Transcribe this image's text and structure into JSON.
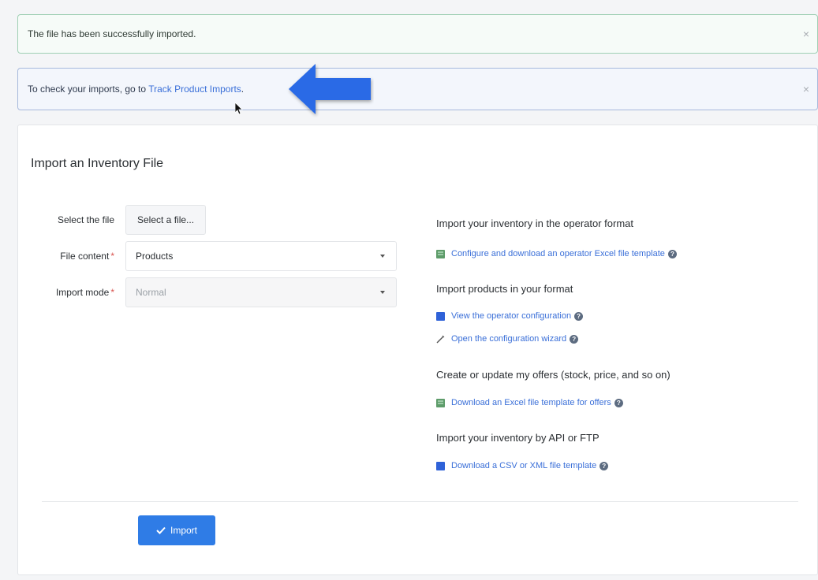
{
  "alerts": {
    "success": {
      "text": "The file has been successfully imported.",
      "close": "×"
    },
    "info": {
      "prefix": "To check your imports, go to ",
      "link": "Track Product Imports",
      "suffix": ".",
      "close": "×"
    }
  },
  "panel": {
    "title": "Import an Inventory File",
    "form": {
      "file_label": "Select the file",
      "file_button": "Select a file...",
      "content_label": "File content",
      "content_value": "Products",
      "mode_label": "Import mode",
      "mode_value": "Normal",
      "required_mark": "*"
    },
    "sections": [
      {
        "heading": "Import your inventory in the operator format",
        "links": [
          {
            "text": "Configure and download an operator Excel file template",
            "icon": "excel-icon"
          }
        ]
      },
      {
        "heading": "Import products in your format",
        "links": [
          {
            "text": "View the operator configuration",
            "icon": "book-icon"
          },
          {
            "text": "Open the configuration wizard",
            "icon": "magic-wand-icon"
          }
        ]
      },
      {
        "heading": "Create or update my offers (stock, price, and so on)",
        "links": [
          {
            "text": "Download an Excel file template for offers",
            "icon": "excel-icon"
          }
        ]
      },
      {
        "heading": "Import your inventory by API or FTP",
        "links": [
          {
            "text": "Download a CSV or XML file template",
            "icon": "book-icon"
          }
        ]
      }
    ],
    "help_glyph": "?",
    "import_button": "Import"
  },
  "colors": {
    "primary": "#2f7ce6",
    "link": "#3a6fd8",
    "success_border": "#9fcfb4",
    "info_border": "#a7b9dc",
    "required": "#d9534f"
  }
}
